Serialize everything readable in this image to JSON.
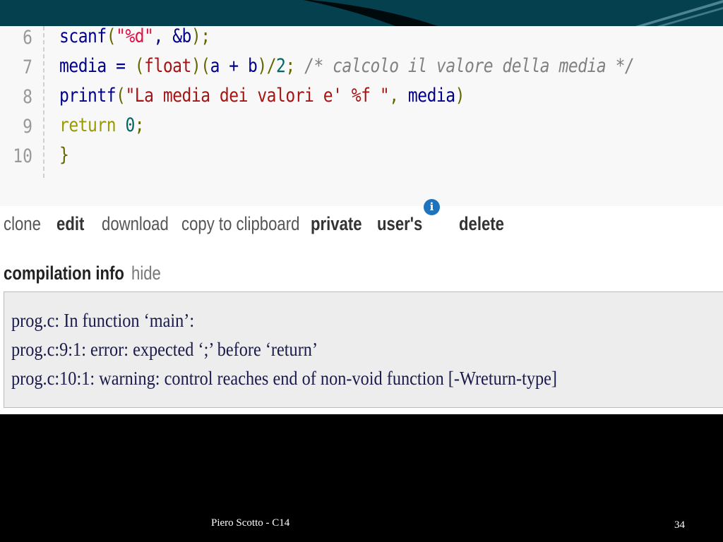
{
  "code": {
    "lines": [
      {
        "num": "6",
        "segments": [
          {
            "t": "scanf",
            "c": "kw-pl"
          },
          {
            "t": "(",
            "c": "kw-pun"
          },
          {
            "t": "\"%d\"",
            "c": "kw-str"
          },
          {
            "t": ", &b",
            "c": "kw-pl"
          },
          {
            "t": ");",
            "c": "kw-pun"
          }
        ]
      },
      {
        "num": "7",
        "segments": [
          {
            "t": "media = ",
            "c": "kw-pl"
          },
          {
            "t": "(",
            "c": "kw-pun"
          },
          {
            "t": "float",
            "c": "kw-str2"
          },
          {
            "t": ")(",
            "c": "kw-pun"
          },
          {
            "t": "a + b",
            "c": "kw-pl"
          },
          {
            "t": ")/",
            "c": "kw-pun"
          },
          {
            "t": "2",
            "c": "kw-lit"
          },
          {
            "t": "; ",
            "c": "kw-pun"
          },
          {
            "t": "/* calcolo il valore della media */",
            "c": "kw-com"
          }
        ]
      },
      {
        "num": "8",
        "segments": [
          {
            "t": "printf",
            "c": "kw-pl"
          },
          {
            "t": "(",
            "c": "kw-pun"
          },
          {
            "t": "\"La media dei valori e' %f \"",
            "c": "kw-str2"
          },
          {
            "t": ", ",
            "c": "kw-pun"
          },
          {
            "t": "media",
            "c": "kw-pl"
          },
          {
            "t": ")",
            "c": "kw-pun"
          }
        ]
      },
      {
        "num": "9",
        "segments": [
          {
            "t": "return ",
            "c": "kw-ret"
          },
          {
            "t": "0",
            "c": "kw-lit"
          },
          {
            "t": ";",
            "c": "kw-pun"
          }
        ]
      },
      {
        "num": "10",
        "segments": [
          {
            "t": "}",
            "c": "kw-pun"
          }
        ]
      }
    ]
  },
  "actions": {
    "clone": "clone",
    "edit": "edit",
    "download": "download",
    "copy": "copy to clipboard",
    "private": "private",
    "users": "user's",
    "info_icon_glyph": "i",
    "delete": "delete"
  },
  "compilation": {
    "title": "compilation info",
    "hide": "hide",
    "lines": [
      "prog.c: In function ‘main’:",
      "prog.c:9:1: error: expected ‘;’ before ‘return’",
      "prog.c:10:1: warning: control reaches end of non-void function [-Wreturn-type]"
    ]
  },
  "footer": {
    "author": "Piero Scotto -   C14",
    "page": "34"
  },
  "colors": {
    "slide_band": "#05404e",
    "info_icon": "#1e73be",
    "compile_bg": "#ededed"
  },
  "icons": {
    "info": "info-circle-icon"
  }
}
